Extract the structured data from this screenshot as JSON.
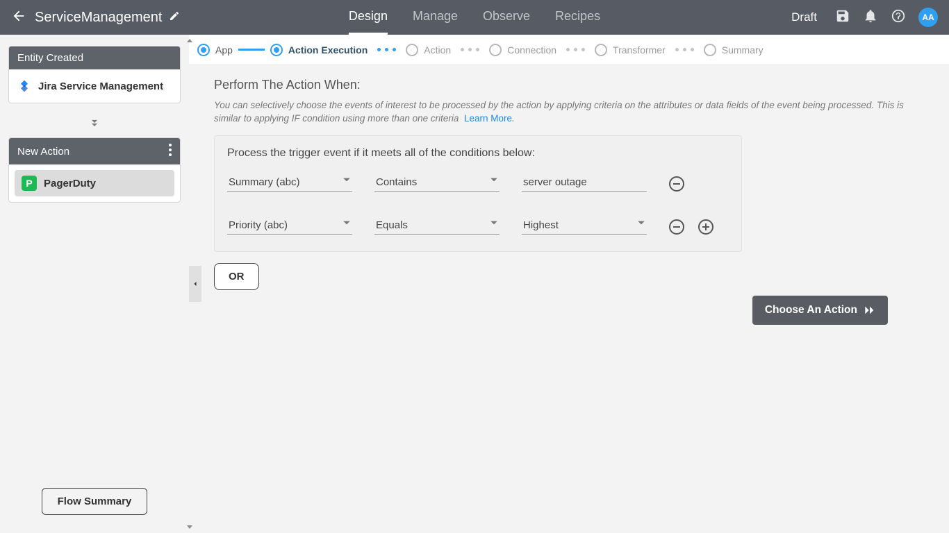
{
  "topbar": {
    "title": "ServiceManagement",
    "nav": [
      "Design",
      "Manage",
      "Observe",
      "Recipes"
    ],
    "active_nav_index": 0,
    "status": "Draft",
    "avatar": "AA"
  },
  "sidebar": {
    "card1": {
      "header": "Entity Created",
      "item": "Jira Service Management"
    },
    "card2": {
      "header": "New Action",
      "item": "PagerDuty",
      "pd_letter": "P"
    },
    "flow_summary": "Flow Summary"
  },
  "stepper": {
    "steps": [
      "App",
      "Action Execution",
      "Action",
      "Connection",
      "Transformer",
      "Summary"
    ]
  },
  "main": {
    "section_title": "Perform The Action When:",
    "section_desc": "You can selectively choose the events of interest to be processed by the action by applying criteria on the attributes or data fields of the event being processed. This is similar to applying IF condition using more than one criteria",
    "learn_more": "Learn More",
    "box_title": "Process the trigger event if it meets all of the conditions below:",
    "rows": [
      {
        "field": "Summary (abc)",
        "operator": "Contains",
        "value": "server outage"
      },
      {
        "field": "Priority (abc)",
        "operator": "Equals",
        "value": "Highest"
      }
    ],
    "or_label": "OR",
    "choose_action": "Choose An Action"
  }
}
